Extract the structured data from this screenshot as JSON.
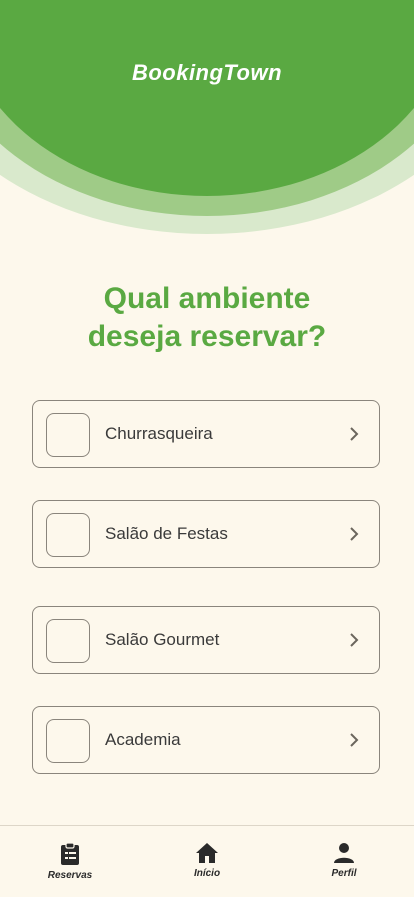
{
  "header": {
    "brand": "BookingTown"
  },
  "main": {
    "question_line1": "Qual ambiente",
    "question_line2": "deseja reservar?",
    "options": [
      {
        "label": "Churrasqueira"
      },
      {
        "label": "Salão de Festas"
      },
      {
        "label": "Salão Gourmet"
      },
      {
        "label": "Academia"
      }
    ]
  },
  "tabbar": {
    "tabs": [
      {
        "label": "Reservas",
        "icon": "clipboard-icon"
      },
      {
        "label": "Início",
        "icon": "home-icon"
      },
      {
        "label": "Perfil",
        "icon": "person-icon"
      }
    ]
  },
  "colors": {
    "primary_green": "#5aa942",
    "background": "#fdf8ec"
  }
}
